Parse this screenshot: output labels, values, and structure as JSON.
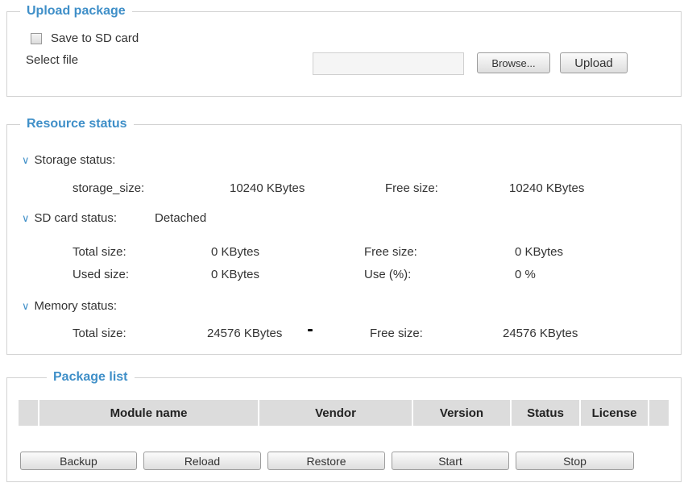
{
  "upload": {
    "legend": "Upload package",
    "save_sd_label": "Save to SD card",
    "select_file_label": "Select file",
    "browse_label": "Browse...",
    "upload_label": "Upload"
  },
  "resource": {
    "legend": "Resource status",
    "storage": {
      "heading": "Storage status:",
      "size_label": "storage_size:",
      "size_value": "10240  KBytes",
      "free_label": "Free size:",
      "free_value": "10240  KBytes"
    },
    "sd": {
      "heading": "SD card status:",
      "state": "Detached",
      "total_label": "Total size:",
      "total_value": "0  KBytes",
      "free_label": "Free size:",
      "free_value": "0  KBytes",
      "used_label": "Used size:",
      "used_value": "0  KBytes",
      "use_label": "Use (%):",
      "use_value": "0 %"
    },
    "memory": {
      "heading": "Memory status:",
      "total_label": "Total size:",
      "total_value": "24576  KBytes",
      "free_label": "Free size:",
      "free_value": "24576  KBytes"
    }
  },
  "packages": {
    "legend": "Package list",
    "columns": [
      "Module name",
      "Vendor",
      "Version",
      "Status",
      "License"
    ],
    "buttons": [
      "Backup",
      "Reload",
      "Restore",
      "Start",
      "Stop"
    ]
  },
  "colors": {
    "accent": "#3f8fc8",
    "header_bg": "#dcdcdc",
    "border": "#d2d2d2"
  }
}
